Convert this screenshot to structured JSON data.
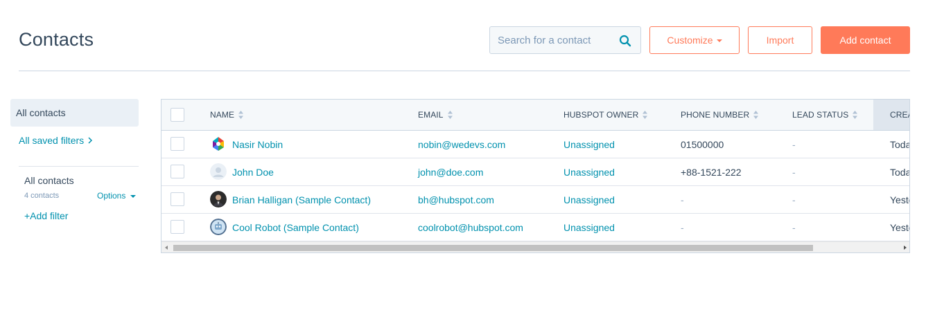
{
  "header": {
    "title": "Contacts",
    "search_placeholder": "Search for a contact",
    "search_icon": "search-icon",
    "customize_label": "Customize",
    "import_label": "Import",
    "add_contact_label": "Add contact"
  },
  "sidebar": {
    "active_view": "All contacts",
    "saved_filters_label": "All saved filters",
    "view_name": "All contacts",
    "view_count": "4 contacts",
    "options_label": "Options",
    "add_filter_label": "+Add filter"
  },
  "table": {
    "columns": [
      "NAME",
      "EMAIL",
      "HUBSPOT OWNER",
      "PHONE NUMBER",
      "LEAD STATUS",
      "CREA"
    ],
    "rows": [
      {
        "name": "Nasir Nobin",
        "email": "nobin@wedevs.com",
        "owner": "Unassigned",
        "phone": "01500000",
        "lead_status": "-",
        "created": "Toda",
        "avatar": "colorful-logo-avatar"
      },
      {
        "name": "John Doe",
        "email": "john@doe.com",
        "owner": "Unassigned",
        "phone": "+88-1521-222",
        "lead_status": "-",
        "created": "Toda",
        "avatar": "default-person-avatar"
      },
      {
        "name": "Brian Halligan (Sample Contact)",
        "email": "bh@hubspot.com",
        "owner": "Unassigned",
        "phone": "-",
        "lead_status": "-",
        "created": "Yeste",
        "avatar": "photo-avatar"
      },
      {
        "name": "Cool Robot (Sample Contact)",
        "email": "coolrobot@hubspot.com",
        "owner": "Unassigned",
        "phone": "-",
        "lead_status": "-",
        "created": "Yeste",
        "avatar": "robot-avatar"
      }
    ]
  },
  "colors": {
    "accent": "#ff7a59",
    "link": "#0091ae",
    "text": "#33475b",
    "border": "#cbd6e2"
  }
}
